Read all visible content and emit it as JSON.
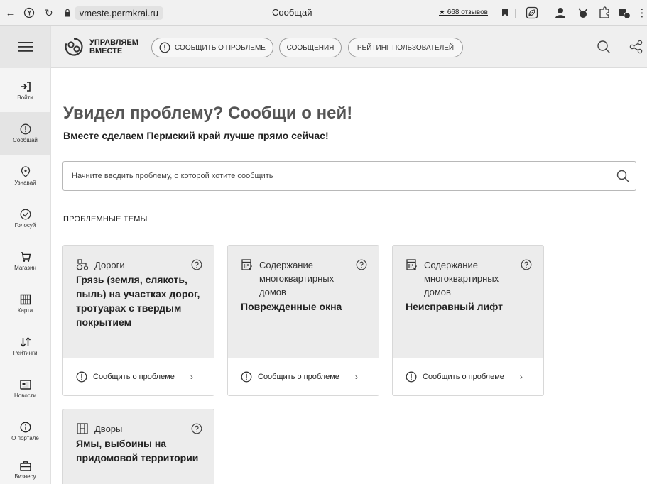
{
  "browser": {
    "url": "vmeste.permkrai.ru",
    "title": "Сообщай",
    "reviews": "★ 668 отзывов"
  },
  "rail": {
    "items": [
      {
        "label": "Войти",
        "icon": "login-icon"
      },
      {
        "label": "Сообщай",
        "icon": "alert-icon"
      },
      {
        "label": "Узнавай",
        "icon": "location-icon"
      },
      {
        "label": "Голосуй",
        "icon": "vote-icon"
      },
      {
        "label": "Магазин",
        "icon": "cart-icon"
      },
      {
        "label": "Карта",
        "icon": "map-icon"
      },
      {
        "label": "Рейтинги",
        "icon": "sort-icon"
      },
      {
        "label": "Новости",
        "icon": "news-icon"
      },
      {
        "label": "О портале",
        "icon": "info-icon"
      },
      {
        "label": "Бизнесу",
        "icon": "briefcase-icon"
      }
    ]
  },
  "header": {
    "logo_line1": "УПРАВЛЯЕМ",
    "logo_line2": "ВМЕСТЕ",
    "nav": [
      "СООБЩИТЬ О ПРОБЛЕМЕ",
      "СООБЩЕНИЯ",
      "РЕЙТИНГ ПОЛЬЗОВАТЕЛЕЙ"
    ]
  },
  "main": {
    "heading": "Увидел проблему? Сообщи о ней!",
    "subheading": "Вместе сделаем Пермский край лучше прямо сейчас!",
    "search_placeholder": "Начните вводить проблему, о которой хотите сообщить",
    "section_title": "ПРОБЛЕМНЫЕ ТЕМЫ",
    "cards": [
      {
        "category": "Дороги",
        "problem": "Грязь (земля, слякоть, пыль) на участках дорог, тротуарах с твердым покрытием",
        "action": "Сообщить о проблеме",
        "icon": "tractor-icon"
      },
      {
        "category": "Содержание многоквартирных домов",
        "problem": "Поврежденные окна",
        "action": "Сообщить о проблеме",
        "icon": "building-icon"
      },
      {
        "category": "Содержание многоквартирных домов",
        "problem": "Неисправный лифт",
        "action": "Сообщить о проблеме",
        "icon": "building-icon"
      },
      {
        "category": "Дворы",
        "problem": "Ямы, выбоины на придомовой территории",
        "action": "",
        "icon": "yard-icon"
      }
    ]
  },
  "colors": {
    "header_bg": "#efefef",
    "card_bg": "#ececec",
    "heading": "#555555"
  }
}
